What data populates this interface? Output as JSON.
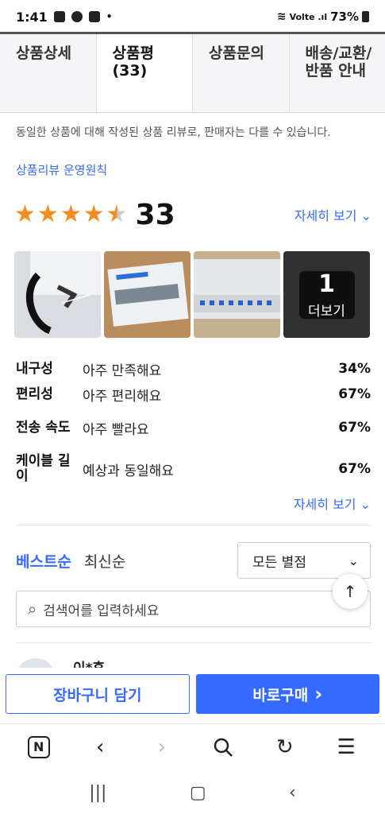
{
  "status": {
    "time": "1:41",
    "dot": "•",
    "network": "Volte .ıl",
    "battery": "73%"
  },
  "tabs": [
    {
      "label": "상품상세"
    },
    {
      "label": "상품평 (33)"
    },
    {
      "label": "상품문의"
    },
    {
      "label": "배송/교환/반품 안내"
    }
  ],
  "notice": "동일한 상품에 대해 작성된 상품 리뷰로, 판매자는 다를 수 있습니다.",
  "policy_link": "상품리뷰 운영원칙",
  "rating": {
    "stars": 4.5,
    "count": "33",
    "detail_link": "자세히 보기 ⌄"
  },
  "thumbnails": {
    "more_count": "1",
    "more_label": "더보기"
  },
  "survey": [
    {
      "question": "내구성",
      "answer": "아주 만족해요",
      "percent": "34%"
    },
    {
      "question": "편리성",
      "answer": "아주 편리해요",
      "percent": "67%"
    },
    {
      "question": "전송 속도",
      "answer": "아주 빨라요",
      "percent": "67%"
    },
    {
      "question": "케이블 길이",
      "answer": "예상과 동일해요",
      "percent": "67%"
    }
  ],
  "detail_link_2": "자세히 보기 ⌄",
  "sort": {
    "best": "베스트순",
    "latest": "최신순",
    "filter_value": "모든 별점"
  },
  "search": {
    "placeholder": "검색어를 입력하세요"
  },
  "reviewer_peek": "이*후",
  "buy_bar": {
    "cart": "장바구니 담기",
    "buy": "바로구매",
    "buy_arrow": "›"
  },
  "icons": {
    "star": "star-icon",
    "search": "search-icon",
    "chevron": "chevron-down-icon",
    "arrow_up": "arrow-up-icon"
  },
  "colors": {
    "accent": "#346aff",
    "star": "#f68b1f"
  }
}
